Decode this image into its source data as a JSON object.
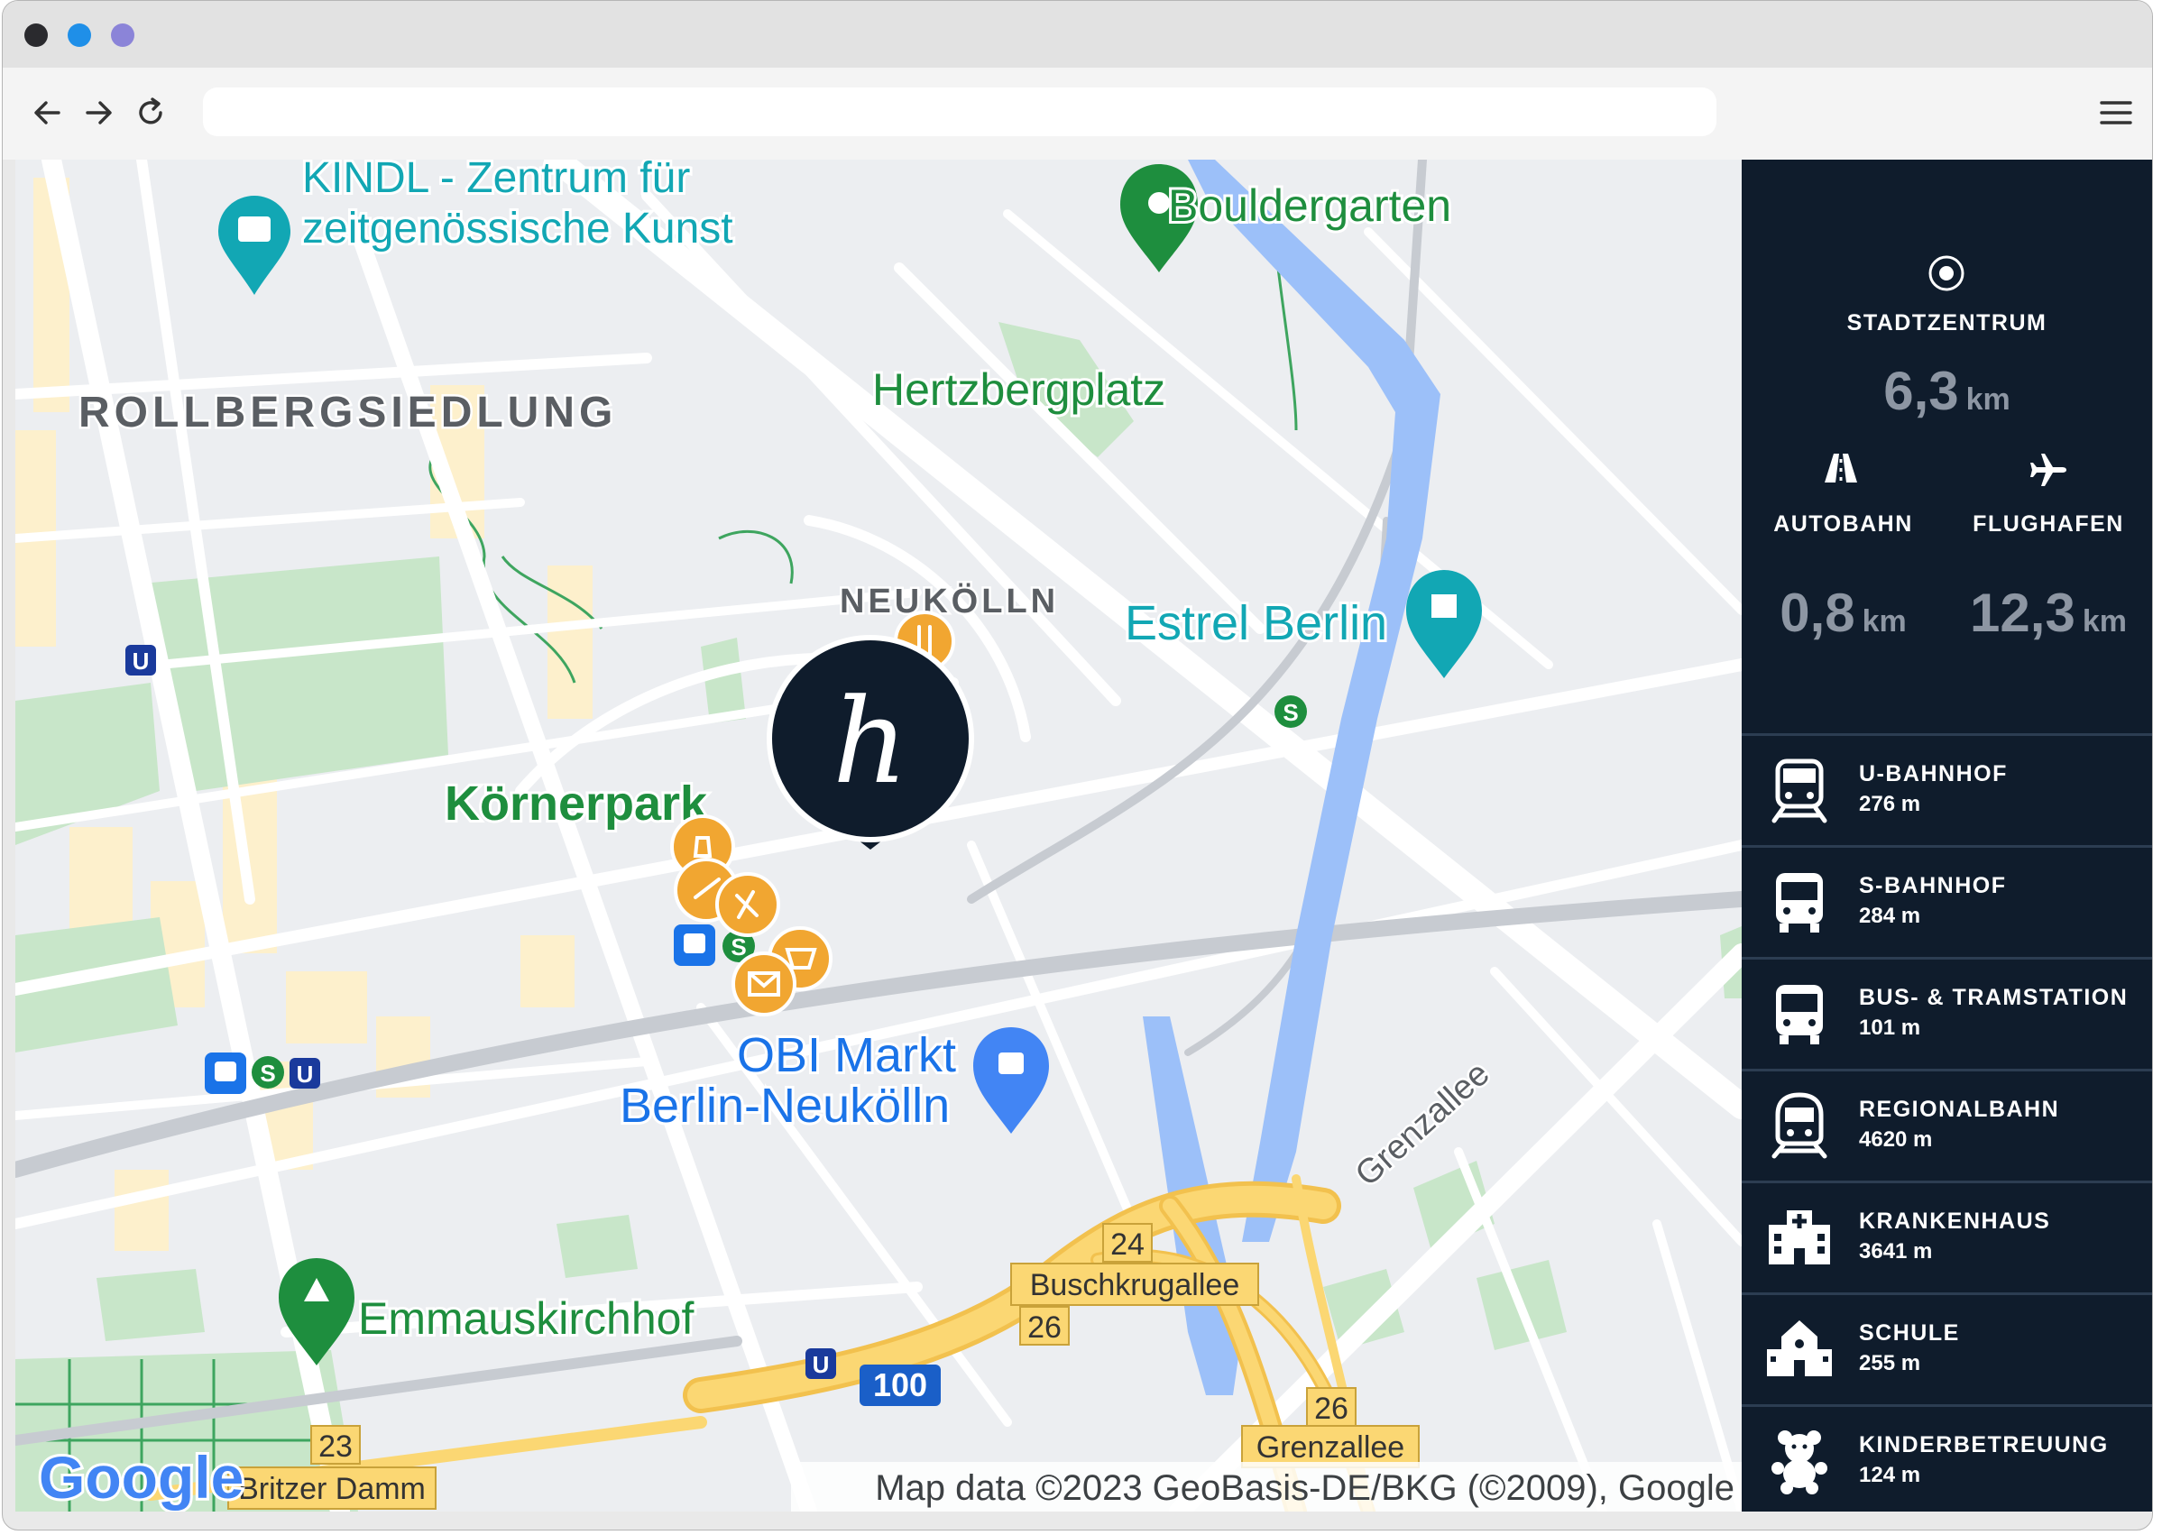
{
  "browser": {
    "dot_colors": [
      "#2a2a2e",
      "#1f8fe8",
      "#8b84d8"
    ],
    "back_icon": "arrow-left-icon",
    "forward_icon": "arrow-right-icon",
    "reload_icon": "reload-icon",
    "menu_icon": "hamburger-menu-icon",
    "url": ""
  },
  "map": {
    "labels": {
      "kindl_1": "KINDL - Zentrum für",
      "kindl_2": "zeitgenössische Kunst",
      "bouldergarten": "Bouldergarten",
      "rollberg": "ROLLBERGSIEDLUNG",
      "hertzberg": "Hertzbergplatz",
      "neukoelln": "NEUKÖLLN",
      "estrel": "Estrel Berlin",
      "koernerpark": "Körnerpark",
      "obi_1": "OBI Markt",
      "obi_2": "Berlin-Neukölln",
      "grenzallee_rot": "Grenzallee",
      "buschkrug": "Buschkrugallee",
      "emmaus": "Emmauskirchhof",
      "grenzallee_sign": "Grenzallee",
      "britzer": "Britzer Damm",
      "r24": "24",
      "r26a": "26",
      "r26b": "26",
      "r23": "23",
      "r100": "100"
    },
    "transit_badges": {
      "u": "U",
      "s": "S"
    },
    "attribution": "Map data ©2023 GeoBasis-DE/BKG (©2009), Google",
    "logo_text": "Google",
    "colors": {
      "water": "#9cc0f9",
      "park": "#c8e6c9",
      "park_text": "#1e8e3e",
      "block": "#fdf0cc",
      "road": "#ffffff",
      "highway": "#fbd773",
      "poi_orange": "#f1a631",
      "marker": "#0f1c2c",
      "teal": "#12a7b4"
    },
    "marker_letter": "h"
  },
  "sidebar": {
    "city_icon": "target-icon",
    "city_label": "STADTZENTRUM",
    "city_value": "6,3",
    "city_unit": "km",
    "autobahn_icon": "highway-icon",
    "autobahn_label": "AUTOBAHN",
    "autobahn_value": "0,8",
    "autobahn_unit": "km",
    "flughafen_icon": "airplane-icon",
    "flughafen_label": "FLUGHAFEN",
    "flughafen_value": "12,3",
    "flughafen_unit": "km",
    "items": [
      {
        "icon": "subway-train-icon",
        "label": "U-BAHNHOF",
        "distance": "276 m"
      },
      {
        "icon": "bus-icon",
        "label": "S-BAHNHOF",
        "distance": "284 m"
      },
      {
        "icon": "bus-icon",
        "label": "BUS- & TRAMSTATION",
        "distance": "101 m"
      },
      {
        "icon": "regional-train-icon",
        "label": "REGIONALBAHN",
        "distance": "4620 m"
      },
      {
        "icon": "hospital-icon",
        "label": "KRANKENHAUS",
        "distance": "3641 m"
      },
      {
        "icon": "school-icon",
        "label": "SCHULE",
        "distance": "255 m"
      },
      {
        "icon": "teddy-bear-icon",
        "label": "KINDERBETREUUNG",
        "distance": "124 m"
      }
    ]
  }
}
